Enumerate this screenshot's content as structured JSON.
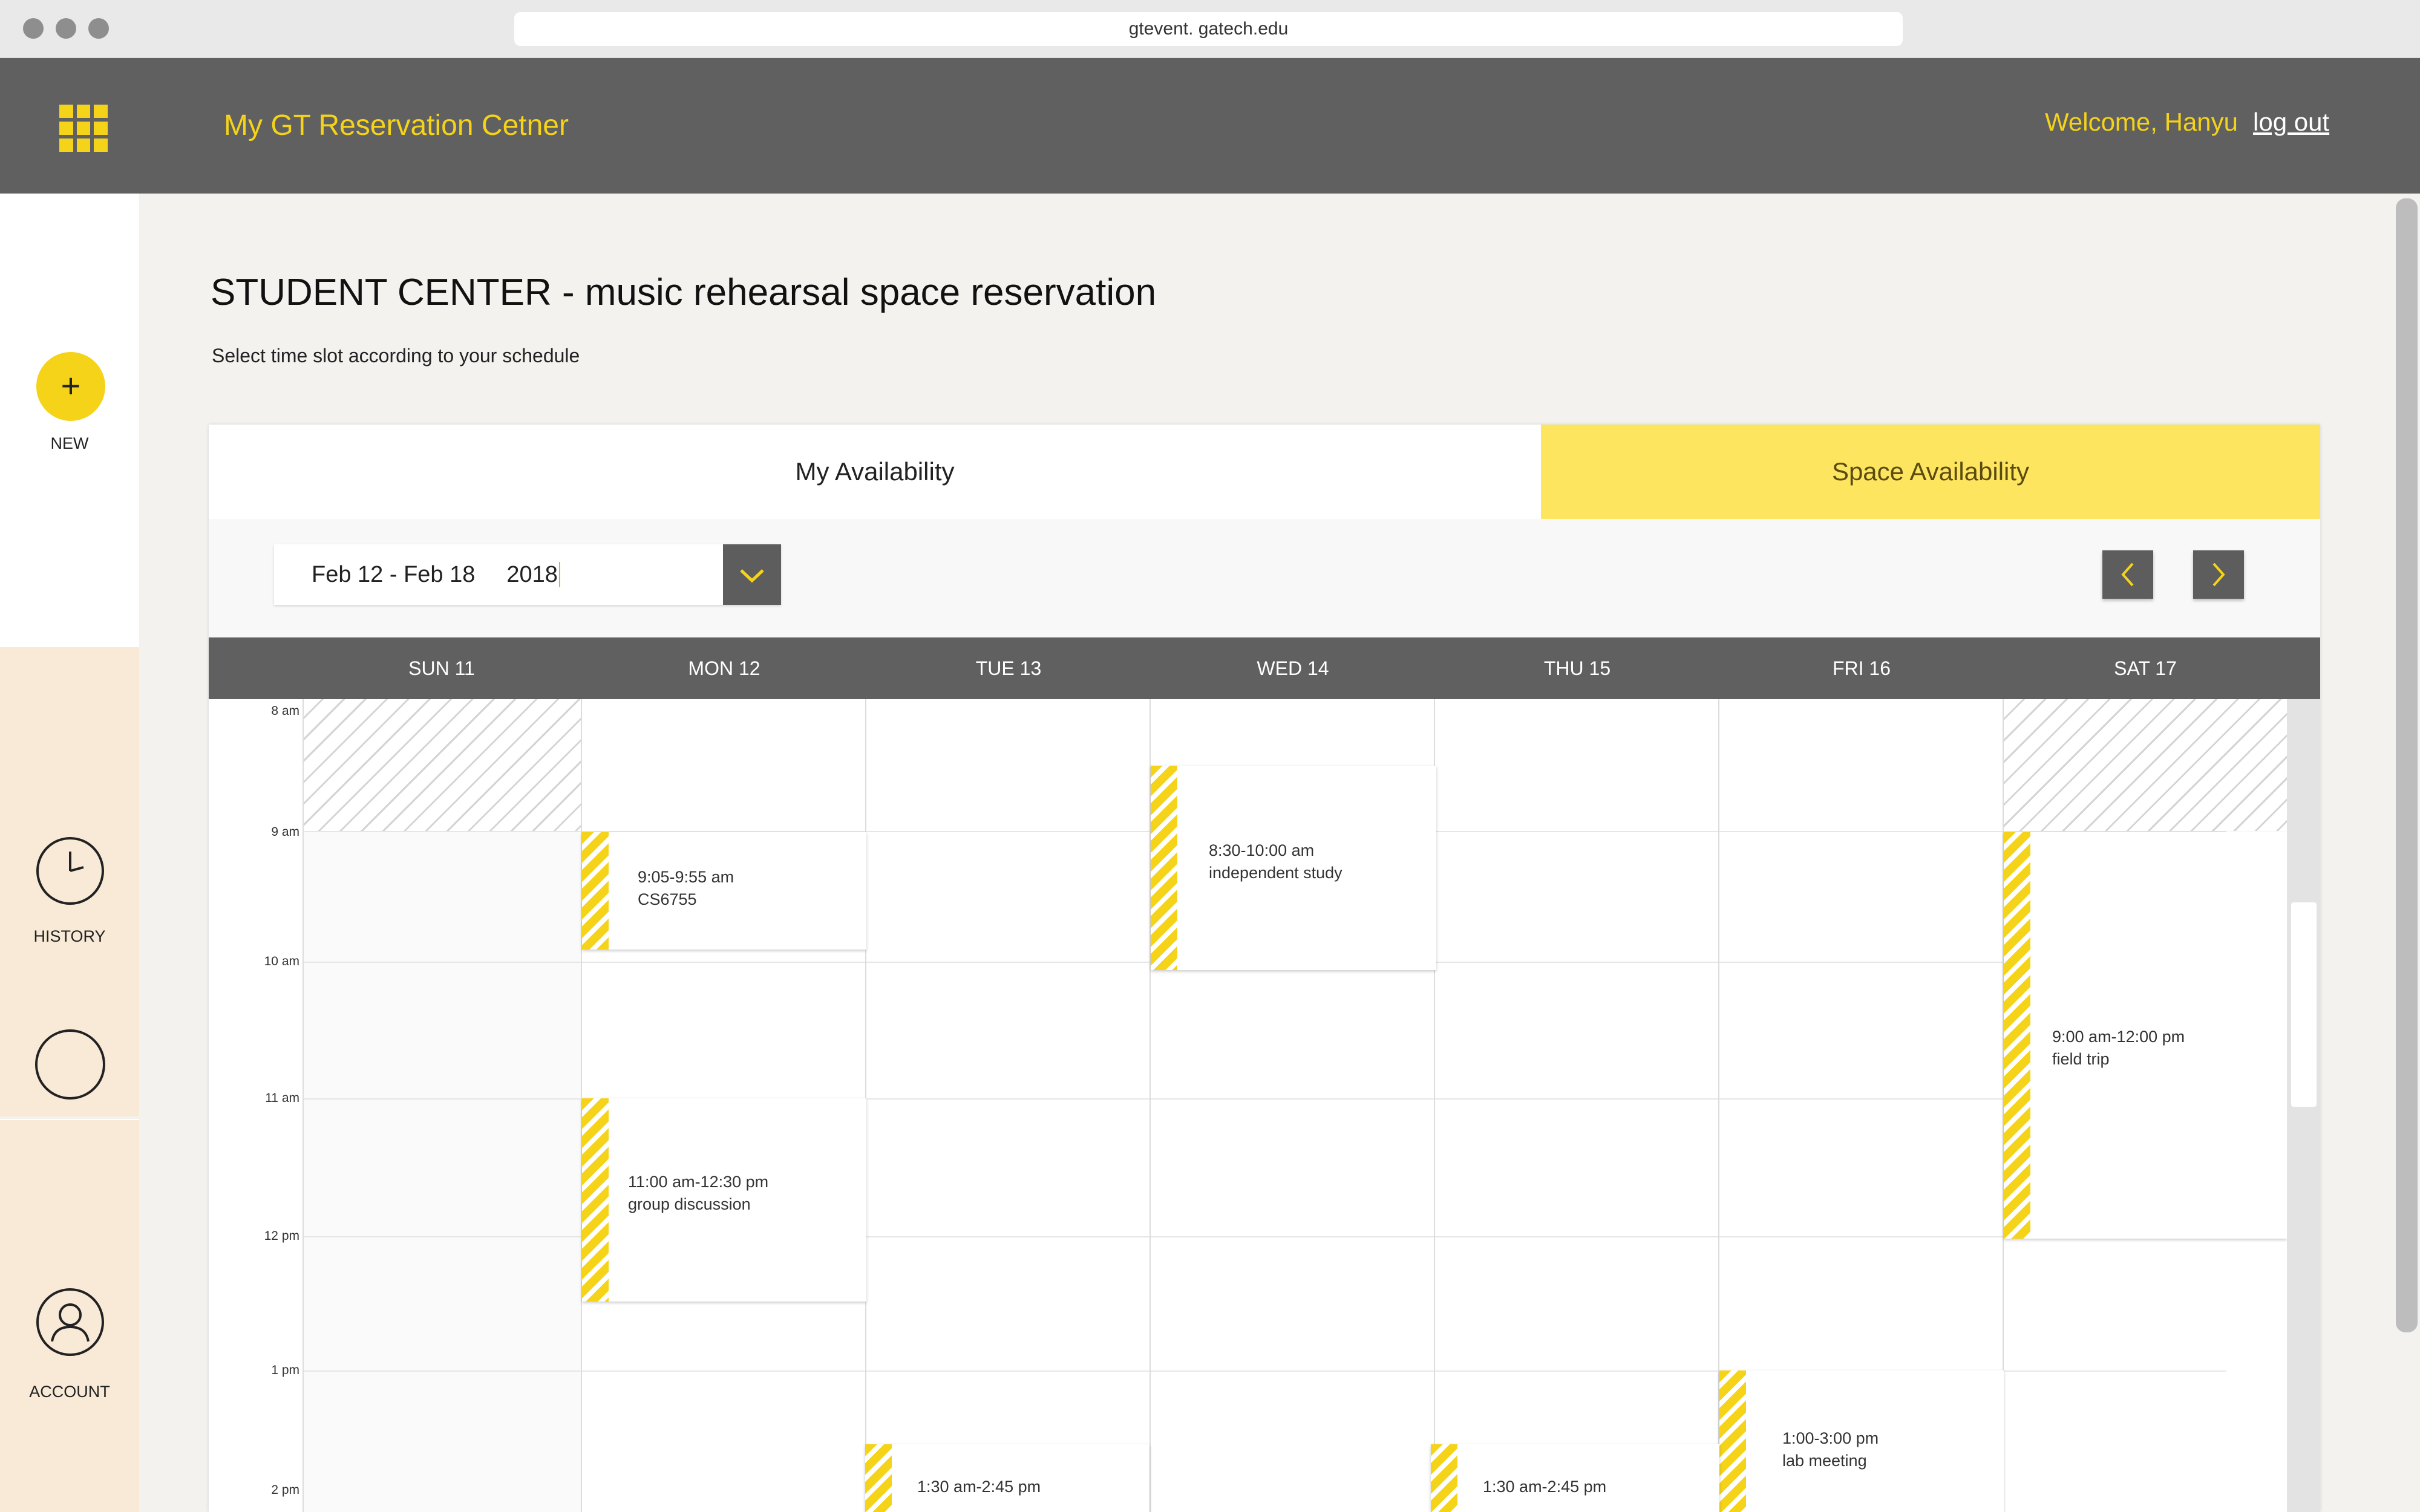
{
  "browser": {
    "url": "gtevent. gatech.edu"
  },
  "appbar": {
    "title": "My GT Reservation Cetner",
    "welcome": "Welcome, Hanyu",
    "logout": "log out"
  },
  "sidebar": {
    "new_label": "NEW",
    "history_label": "HISTORY",
    "account_label": "ACCOUNT"
  },
  "page": {
    "title": "STUDENT CENTER - music rehearsal space reservation",
    "subtitle": "Select time slot according to your schedule"
  },
  "tabs": {
    "my": "My Availability",
    "space": "Space Availability"
  },
  "date_select": {
    "range": "Feb 12 - Feb 18",
    "year": "2018"
  },
  "days": [
    "SUN 11",
    "MON 12",
    "TUE 13",
    "WED 14",
    "THU 15",
    "FRI 16",
    "SAT 17"
  ],
  "times": [
    "8 am",
    "9 am",
    "10 am",
    "11 am",
    "12 pm",
    "1 pm",
    "2 pm"
  ],
  "events": [
    {
      "time": "9:05-9:55 am",
      "title": "CS6755"
    },
    {
      "time": "8:30-10:00 am",
      "title": "independent study"
    },
    {
      "time": "9:00 am-12:00 pm",
      "title": "field trip"
    },
    {
      "time": "11:00 am-12:30 pm",
      "title": "group discussion"
    },
    {
      "time": "1:00-3:00 pm",
      "title": "lab meeting"
    },
    {
      "time": "1:30 am-2:45 pm",
      "title": ""
    },
    {
      "time": "1:30 am-2:45 pm",
      "title": ""
    }
  ],
  "colors": {
    "accent": "#f5d319",
    "tab_active": "#fee55f",
    "bar": "#606060",
    "sidebar_tint": "#f8ead7"
  },
  "icons": [
    "grid-logo-icon",
    "plus-icon",
    "clock-icon",
    "user-icon",
    "chevron-down-icon",
    "chevron-left-icon",
    "chevron-right-icon"
  ]
}
